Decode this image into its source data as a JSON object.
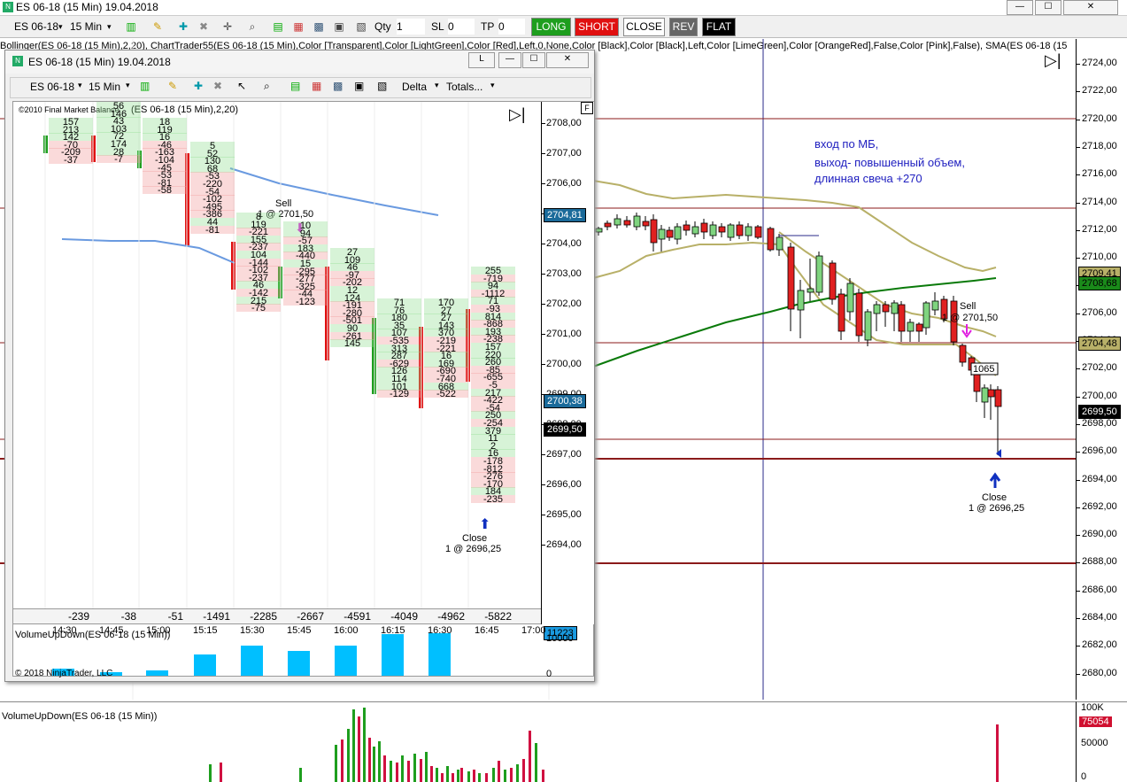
{
  "window": {
    "title": "ES 06-18 (15 Min)  19.04.2018",
    "minimize": "—",
    "maximize": "☐",
    "close": "✕"
  },
  "toolbar": {
    "instrument": "ES 06-18",
    "interval": "15 Min",
    "qty_label": "Qty",
    "qty_value": "1",
    "sl_label": "SL",
    "sl_value": "0",
    "tp_label": "TP",
    "tp_value": "0",
    "long": "LONG",
    "short": "SHORT",
    "close": "CLOSE",
    "rev": "REV",
    "flat": "FLAT"
  },
  "indicator_line": "Bollinger(ES 06-18 (15 Min),2,20), ChartTrader55(ES 06-18 (15 Min),Color [Transparent],Color [LightGreen],Color [Red],Left,0,None,Color [Black],Color [Black],Left,Color [LimeGreen],Color [OrangeRed],False,Color [Pink],False), SMA(ES 06-18 (15",
  "annotation": {
    "line1": "вход по МБ,",
    "line2": " выход- повышенный объем,",
    "line3": "длинная свеча +270"
  },
  "main_chart": {
    "sell_label": "Sell",
    "sell_detail": "1 @ 2701,50",
    "close_label": "Close",
    "close_detail": "1 @ 2696,25",
    "volume_label": "1065",
    "price_badges": [
      {
        "text": "2709,41",
        "color": "#b8b068"
      },
      {
        "text": "2708,68",
        "color": "#1a8a1a"
      },
      {
        "text": "2704,48",
        "color": "#b8b068"
      },
      {
        "text": "2699,50",
        "color": "#000000"
      }
    ],
    "axis_ticks": [
      "2724,00",
      "2722,00",
      "2720,00",
      "2718,00",
      "2716,00",
      "2714,00",
      "2712,00",
      "2710,00",
      "2708,00",
      "2706,00",
      "2704,00",
      "2702,00",
      "2700,00",
      "2698,00",
      "2696,00",
      "2694,00",
      "2692,00",
      "2690,00",
      "2688,00",
      "2686,00",
      "2684,00",
      "2682,00",
      "2680,00"
    ]
  },
  "volume_panel": {
    "label": "VolumeUpDown(ES 06-18 (15 Min))",
    "axis_ticks": [
      "100K",
      "50000",
      "0"
    ],
    "badge": "75054"
  },
  "subwindow": {
    "title": "ES 06-18 (15 Min)  19.04.2018",
    "link_btn": "L",
    "instrument": "ES 06-18",
    "interval": "15 Min",
    "delta_menu": "Delta",
    "totals_menu": "Totals...",
    "copyright_top": "©2010 Final Market Balance",
    "indicator_label": "(ES 06-18 (15 Min),2,20)",
    "f_button": "F",
    "price_marker_top": "2704,81",
    "price_marker_mid": "2700,38",
    "price_marker_cur": "2699,50",
    "sell_label": "Sell",
    "sell_detail": "1 @ 2701,50",
    "close_label": "Close",
    "close_detail": "1 @ 2696,25",
    "axis_ticks": [
      "2708,00",
      "2707,00",
      "2706,00",
      "2705,00",
      "2704,00",
      "2703,00",
      "2702,00",
      "2701,00",
      "2700,00",
      "2699,00",
      "2698,00",
      "2697,00",
      "2696,00",
      "2695,00",
      "2694,00"
    ],
    "deltas": [
      "-239",
      "-38",
      "-51",
      "-1491",
      "-2285",
      "-2667",
      "-4591",
      "-4049",
      "-4962",
      "-5822"
    ],
    "volume_label": "VolumeUpDown(ES 06-18 (15 Min))",
    "volume_badge": "11223",
    "volume_axis": [
      "10000",
      "0"
    ],
    "copyright_bottom": "© 2018 NinjaTrader, LLC",
    "time_ticks": [
      "14:30",
      "14:45",
      "15:00",
      "15:15",
      "15:30",
      "15:45",
      "16:00",
      "16:15",
      "16:30",
      "16:45",
      "17:00"
    ],
    "footprint_columns": [
      {
        "cells": [
          "157",
          "213",
          "142",
          "-70",
          "-209",
          "-37"
        ]
      },
      {
        "cells": [
          "56",
          "146",
          "43",
          "103",
          "72",
          "174",
          "28",
          "-7"
        ]
      },
      {
        "cells": [
          "18",
          "119",
          "16",
          "-46",
          "-163",
          "-104",
          "-45",
          "-53",
          "-81",
          "-58"
        ]
      },
      {
        "cells": [
          "5",
          "52",
          "130",
          "68",
          "-53",
          "-220",
          "-54",
          "-102",
          "-495",
          "-386",
          "44",
          "-81"
        ]
      },
      {
        "cells": [
          "8",
          "119",
          "-221",
          "155",
          "-237",
          "104",
          "-144",
          "-102",
          "-237",
          "46",
          "-142",
          "215",
          "-75"
        ]
      },
      {
        "cells": [
          "10",
          "94",
          "-57",
          "183",
          "-440",
          "15",
          "-295",
          "-277",
          "-325",
          "-44",
          "-123"
        ]
      },
      {
        "cells": [
          "27",
          "109",
          "46",
          "-97",
          "-202",
          "12",
          "124",
          "-191",
          "-280",
          "-501",
          "90",
          "-261",
          "145"
        ]
      },
      {
        "cells": [
          "71",
          "76",
          "180",
          "35",
          "107",
          "-535",
          "313",
          "287",
          "-629",
          "126",
          "114",
          "101",
          "-129"
        ]
      },
      {
        "cells": [
          "170",
          "27",
          "27",
          "143",
          "370",
          "-219",
          "-221",
          "16",
          "169",
          "-690",
          "-740",
          "668",
          "-522"
        ]
      },
      {
        "cells": [
          "255",
          "-719",
          "94",
          "-1112",
          "71",
          "-93",
          "814",
          "-868",
          "193",
          "-238",
          "157",
          "220",
          "260",
          "-85",
          "-655",
          "-5",
          "217",
          "-422",
          "-54",
          "250",
          "-254",
          "379",
          "11",
          "2",
          "16",
          "-178",
          "-812",
          "-276",
          "-170",
          "184",
          "-235"
        ]
      }
    ]
  },
  "colors": {
    "long": "#1e9e1e",
    "short": "#e01010",
    "accent": "#000080",
    "sma": "#0a7a0a",
    "bollinger": "#b8b068"
  }
}
